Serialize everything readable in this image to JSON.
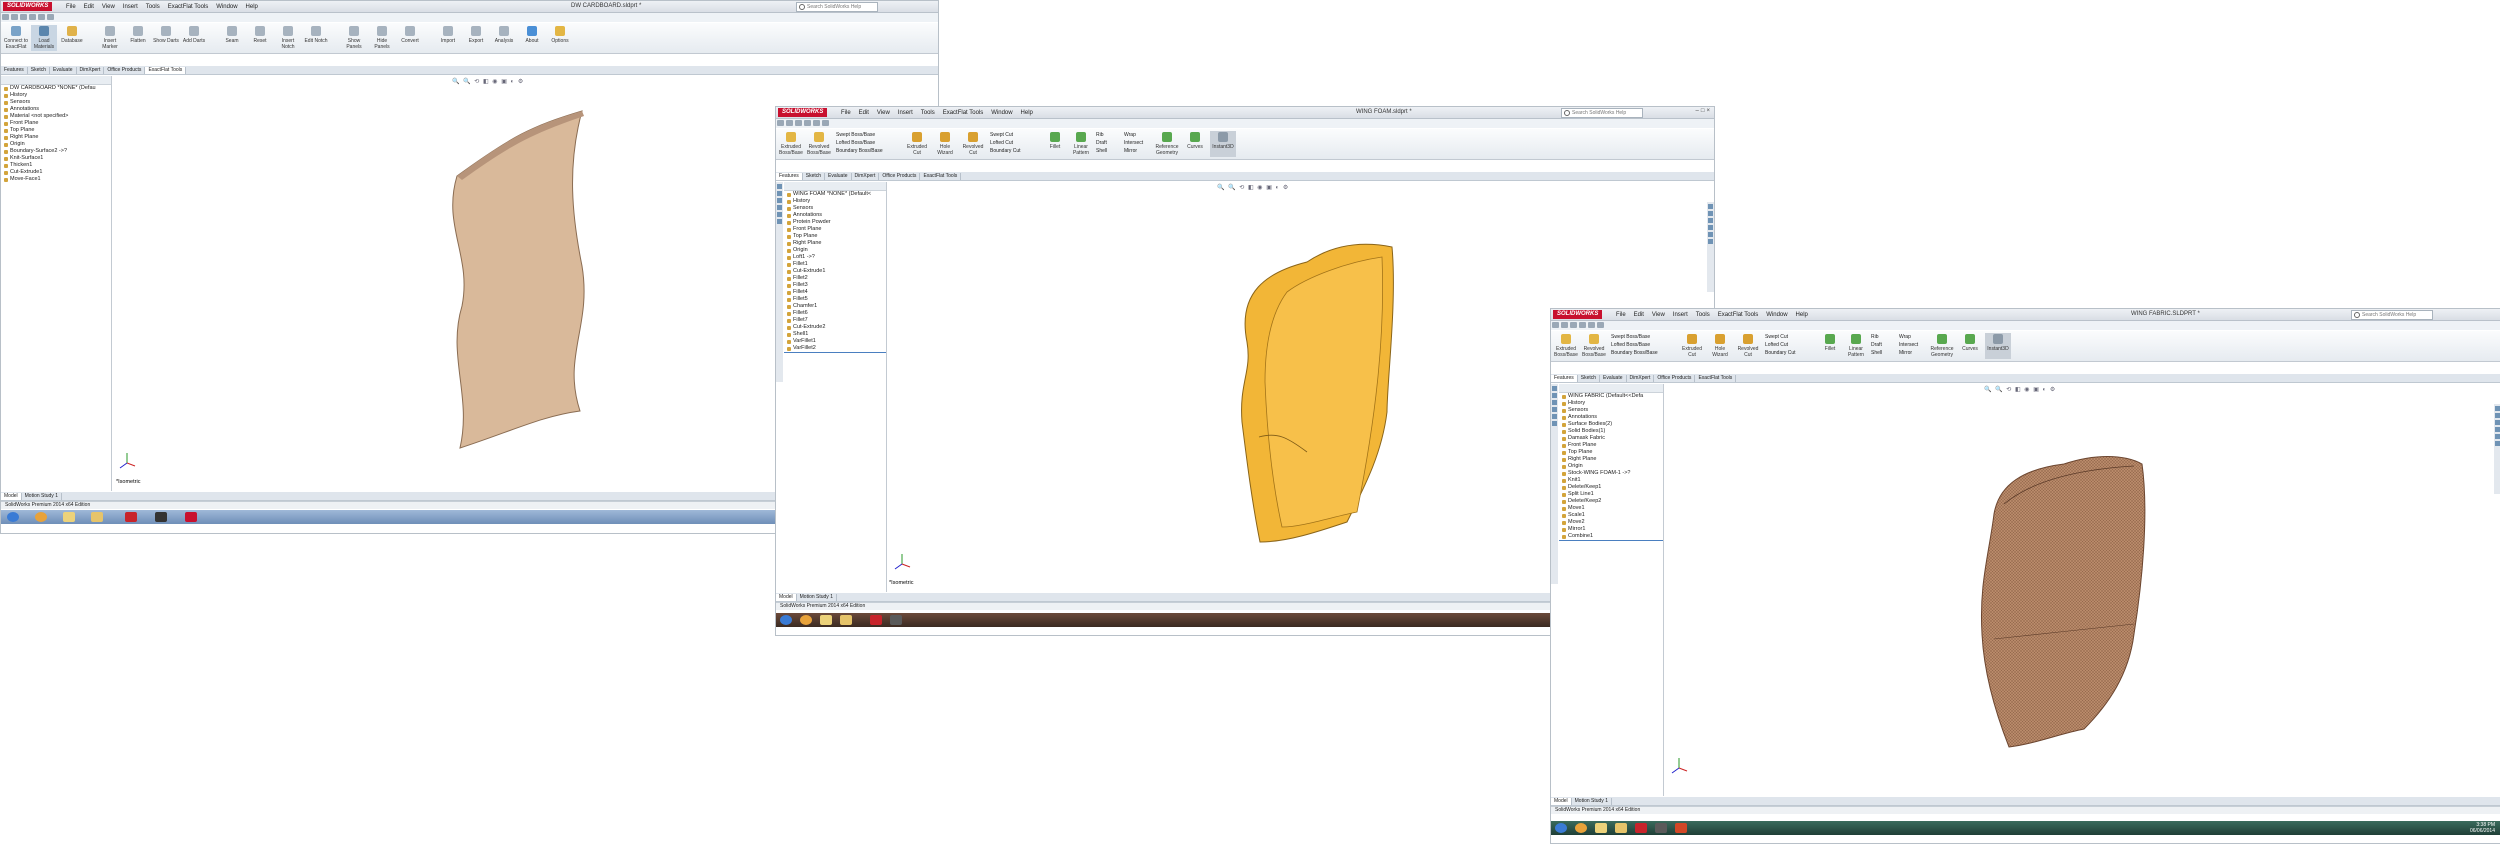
{
  "windows": [
    {
      "id": "left",
      "menus": [
        "File",
        "Edit",
        "View",
        "Insert",
        "Tools",
        "ExactFlat Tools",
        "Window",
        "Help"
      ],
      "logo": "SOLIDWORKS",
      "title": "DW CARDBOARD.sldprt *",
      "search_placeholder": "Search SolidWorks Help",
      "ribbon_buttons": [
        "Connect to ExactFlat",
        "Load Materials",
        "Database",
        "Insert Marker",
        "Flatten",
        "Show Darts",
        "Add Darts",
        "Seam",
        "Reset",
        "Insert Notch",
        "Edit Notch",
        "Show Panels",
        "Hide Panels",
        "Convert",
        "Import",
        "Export",
        "Analysis",
        "Mesh",
        "Print",
        "Nest",
        "About",
        "Options"
      ],
      "tabs": [
        "Features",
        "Sketch",
        "Evaluate",
        "DimXpert",
        "Office Products",
        "ExactFlat Tools"
      ],
      "active_tab": "ExactFlat Tools",
      "tree": [
        "DW CARDBOARD *NONE* (Defau",
        "History",
        "Sensors",
        "Annotations",
        "Material <not specified>",
        "Front Plane",
        "Top Plane",
        "Right Plane",
        "Origin",
        "Boundary-Surface2 ->?",
        "Knit-Surface1",
        "Thicken1",
        "Cut-Extrude1",
        "Move-Face1"
      ],
      "view_label": "*Isometric",
      "bottom_tabs": [
        "Model",
        "Motion Study 1"
      ],
      "status": "SolidWorks Premium 2014 x64 Edition"
    },
    {
      "id": "middle",
      "menus": [
        "File",
        "Edit",
        "View",
        "Insert",
        "Tools",
        "ExactFlat Tools",
        "Window",
        "Help"
      ],
      "logo": "SOLIDWORKS",
      "title": "WING FOAM.sldprt *",
      "search_placeholder": "Search SolidWorks Help",
      "ribbon_buttons": [
        "Extruded Boss/Base",
        "Revolved Boss/Base",
        "Swept Boss/Base",
        "Lofted Boss/Base",
        "Boundary Boss/Base",
        "Extruded Cut",
        "Hole Wizard",
        "Revolved Cut",
        "Swept Cut",
        "Lofted Cut",
        "Boundary Cut",
        "Fillet",
        "Linear Pattern",
        "Rib",
        "Draft",
        "Shell",
        "Wrap",
        "Intersect",
        "Mirror",
        "Reference Geometry",
        "Curves",
        "Instant3D"
      ],
      "tabs": [
        "Features",
        "Sketch",
        "Evaluate",
        "DimXpert",
        "Office Products",
        "ExactFlat Tools"
      ],
      "active_tab": "Features",
      "tree": [
        "WING FOAM *NONE* (Default<",
        "History",
        "Sensors",
        "Annotations",
        "Protein Powder",
        "Front Plane",
        "Top Plane",
        "Right Plane",
        "Origin",
        "Loft1 ->?",
        "Fillet1",
        "Cut-Extrude1",
        "Fillet2",
        "Fillet3",
        "Fillet4",
        "Fillet5",
        "Chamfer1",
        "Fillet6",
        "Fillet7",
        "Cut-Extrude2",
        "Shell1",
        "VarFillet1",
        "VarFillet2"
      ],
      "view_label": "*Isometric",
      "bottom_tabs": [
        "Model",
        "Motion Study 1"
      ],
      "status": "SolidWorks Premium 2014 x64 Edition"
    },
    {
      "id": "right",
      "menus": [
        "File",
        "Edit",
        "View",
        "Insert",
        "Tools",
        "ExactFlat Tools",
        "Window",
        "Help"
      ],
      "logo": "SOLIDWORKS",
      "title": "WING FABRIC.SLDPRT *",
      "search_placeholder": "Search SolidWorks Help",
      "ribbon_buttons": [
        "Extruded Boss/Base",
        "Revolved Boss/Base",
        "Swept Boss/Base",
        "Lofted Boss/Base",
        "Boundary Boss/Base",
        "Extruded Cut",
        "Hole Wizard",
        "Revolved Cut",
        "Swept Cut",
        "Lofted Cut",
        "Boundary Cut",
        "Fillet",
        "Linear Pattern",
        "Rib",
        "Draft",
        "Shell",
        "Wrap",
        "Intersect",
        "Mirror",
        "Reference Geometry",
        "Curves",
        "Instant3D"
      ],
      "tabs": [
        "Features",
        "Sketch",
        "Evaluate",
        "DimXpert",
        "Office Products",
        "ExactFlat Tools"
      ],
      "active_tab": "Features",
      "tree": [
        "WING FABRIC (Default<<Defa",
        "History",
        "Sensors",
        "Annotations",
        "Surface Bodies(2)",
        "Solid Bodies(1)",
        "Damask Fabric",
        "Front Plane",
        "Top Plane",
        "Right Plane",
        "Origin",
        "Stock-WING FOAM-1 ->?",
        "Knit1",
        "Delete/Keep1",
        "Split Line1",
        "Delete/Keep2",
        "Move1",
        "Scale1",
        "Move2",
        "Mirror1",
        "Combine1"
      ],
      "view_label": "*Isometric",
      "bottom_tabs": [
        "Model",
        "Motion Study 1"
      ],
      "status": "SolidWorks Premium 2014 x64 Edition",
      "clock": "3:38 PM",
      "date": "06/06/2014"
    }
  ],
  "colors": {
    "cardboard": "#d9b99a",
    "foam": "#f2b637",
    "fabric": "#b98a6a",
    "logo_red": "#c8102e"
  }
}
